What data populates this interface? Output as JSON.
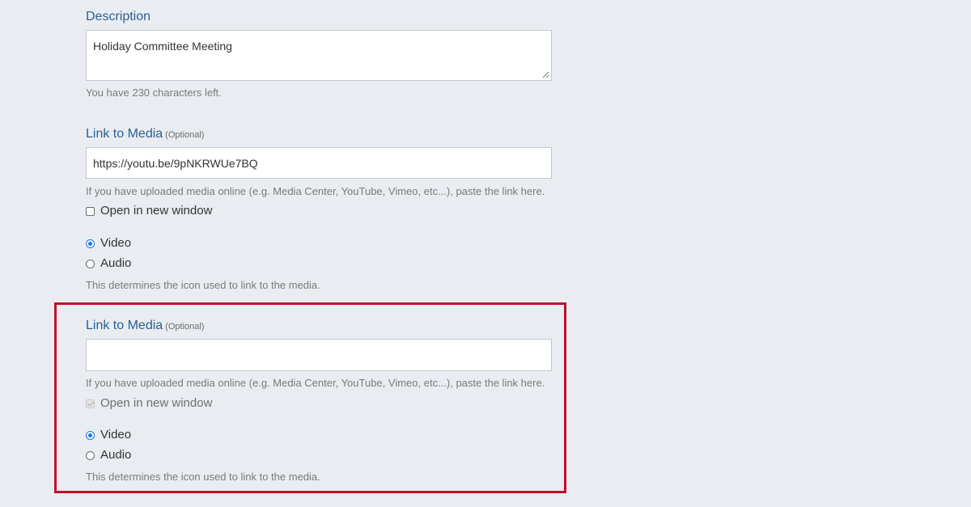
{
  "description": {
    "label": "Description",
    "value": "Holiday Committee Meeting",
    "chars_left": "You have 230 characters left."
  },
  "media_1": {
    "label": "Link to Media",
    "optional": "(Optional)",
    "url_value": "https://youtu.be/9pNKRWUe7BQ",
    "help": "If you have uploaded media online (e.g. Media Center, YouTube, Vimeo, etc...), paste the link here.",
    "new_window_label": "Open in new window",
    "new_window_checked": false,
    "radio_video": "Video",
    "radio_audio": "Audio",
    "selected": "Video",
    "icon_help": "This determines the icon used to link to the media."
  },
  "media_2": {
    "label": "Link to Media",
    "optional": "(Optional)",
    "url_value": "",
    "help": "If you have uploaded media online (e.g. Media Center, YouTube, Vimeo, etc...), paste the link here.",
    "new_window_label": "Open in new window",
    "new_window_checked": true,
    "new_window_disabled": true,
    "radio_video": "Video",
    "radio_audio": "Audio",
    "selected": "Video",
    "icon_help": "This determines the icon used to link to the media."
  },
  "colors": {
    "background": "#e9edf1",
    "label": "#2c5f8d",
    "highlight_border": "#c0102a",
    "radio_accent": "#1a73e8"
  }
}
